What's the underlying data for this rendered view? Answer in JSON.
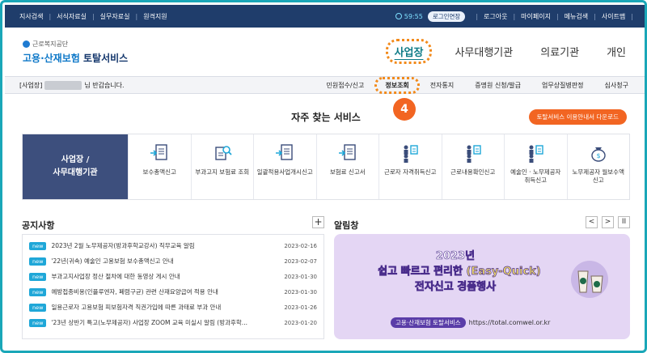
{
  "util_bar": {
    "left_links": [
      "지사검색",
      "서식자료실",
      "실무자료실",
      "원격지원"
    ],
    "timer": "59:55",
    "extend_label": "로그인연장",
    "right_links": [
      "로그아웃",
      "마이페이지",
      "메뉴검색",
      "사이트맵"
    ]
  },
  "header": {
    "org_name": "근로복지공단",
    "service_title_a": "고용·산재보험",
    "service_title_b": " 토탈서비스",
    "user_tabs": [
      "사업장",
      "사무대행기관",
      "의료기관",
      "개인"
    ]
  },
  "gnb": {
    "welcome_prefix": "[사업장]",
    "welcome_suffix": "님 반갑습니다.",
    "menu": [
      "민원접수/신고",
      "정보조회",
      "전자통지",
      "증명원 신청/발급",
      "업무상질병판정",
      "심사청구"
    ]
  },
  "quick": {
    "title": "자주 찾는 서비스",
    "step_number": "4",
    "guide_button": "토탈서비스 이용안내서 다운로드",
    "side_label_1": "사업장 /",
    "side_label_2": "사무대행기관",
    "services": [
      {
        "icon": "document-arrow-icon",
        "label": "보수총액신고"
      },
      {
        "icon": "document-search-icon",
        "label": "부과고지 보험료 조회"
      },
      {
        "icon": "document-arrow-icon",
        "label": "일괄적용사업개시신고"
      },
      {
        "icon": "document-arrow-icon",
        "label": "보험료 신고서"
      },
      {
        "icon": "people-doc-icon",
        "label": "근로자 자격취득신고"
      },
      {
        "icon": "people-doc-icon",
        "label": "근로내용확인신고"
      },
      {
        "icon": "people-doc-icon",
        "label": "예술인 · 노무제공자 취득신고"
      },
      {
        "icon": "money-bag-icon",
        "label": "노무제공자 월보수액 신고"
      }
    ]
  },
  "notice": {
    "title": "공지사항",
    "plus": "+",
    "badge": "new",
    "items": [
      {
        "text": "2023년 2월 노무제공자(방과후학교강사) 직무교육 알림",
        "date": "2023-02-16"
      },
      {
        "text": "'22년(귀속) 예술인 고용보험 보수총액신고 안내",
        "date": "2023-02-07"
      },
      {
        "text": "부과고지사업장 정산 절차에 대한 동영상 게시 안내",
        "date": "2023-01-30"
      },
      {
        "text": "예방접종비용(인플루엔자, 폐렴구균) 관련 산재요양급여 적용 안내",
        "date": "2023-01-30"
      },
      {
        "text": "일용근로자 고용보험 피보험자격 직권가입에 따른 과태료 부과 안내",
        "date": "2023-01-26"
      },
      {
        "text": "'23년 상반기 특고(노무제공자) 사업장 ZOOM 교육 미실시 알림 (방과후학...",
        "date": "2023-01-20"
      }
    ]
  },
  "alarm": {
    "title": "알림창",
    "prev": "<",
    "next": ">",
    "pause": "II",
    "banner_year": "2023년",
    "banner_line1": "쉽고 빠르고 편리한 (Easy-Quick)",
    "banner_line2": "전자신고 경품행사",
    "banner_tag": "고용·산재보험 토탈서비스",
    "banner_url": "https://total.comwel.or.kr"
  },
  "colors": {
    "frame": "#1aa7b8",
    "navy": "#1f3d6b",
    "highlight": "#f28a1b",
    "badge": "#f26522",
    "new_badge": "#1fa7d8",
    "banner_bg": "#e4d6f4"
  }
}
